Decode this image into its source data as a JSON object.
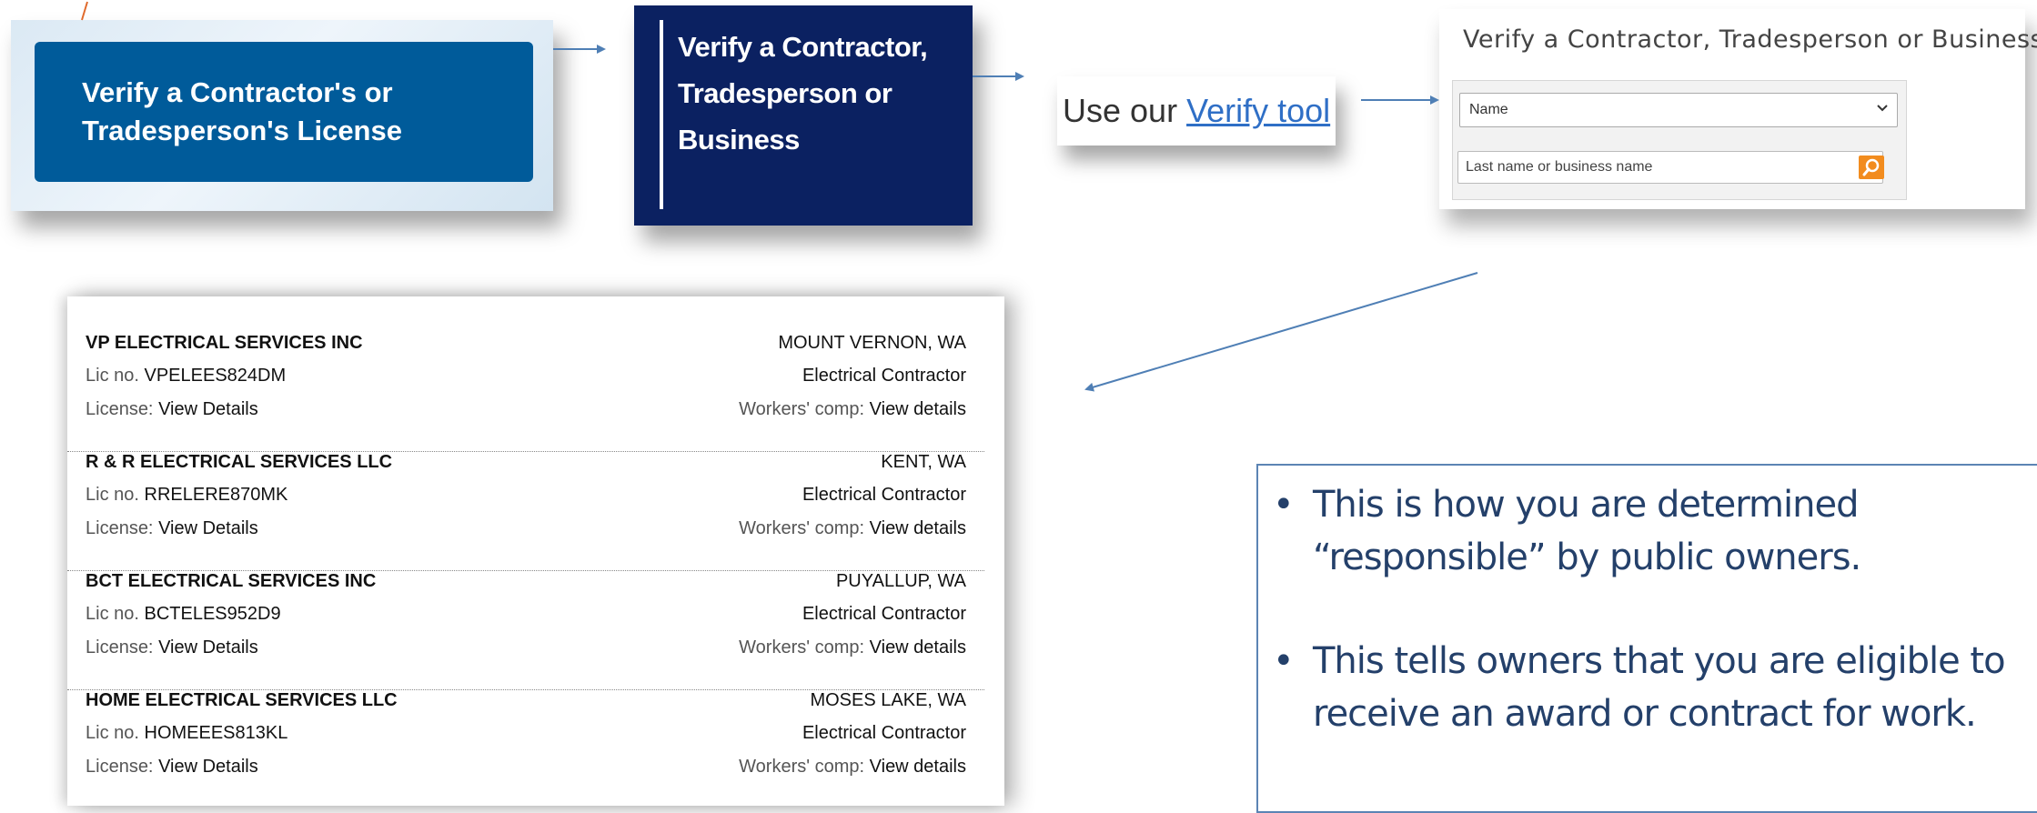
{
  "panel1": {
    "button_label": "Verify a Contractor's or Tradesperson's License"
  },
  "panel2": {
    "button_label": "Verify a Contractor, Tradesperson or Business"
  },
  "panel3": {
    "prefix": "Use our",
    "link": "Verify tool"
  },
  "panel4": {
    "title": "Verify a Contractor, Tradesperson or Business",
    "search_type": "Name",
    "search_placeholder": "Last name or business name"
  },
  "results": [
    {
      "name": "VP ELECTRICAL SERVICES INC",
      "location": "MOUNT VERNON, WA",
      "lic_label": "Lic no.",
      "lic_no": "VPELEES824DM",
      "type": "Electrical Contractor",
      "license_label": "License:",
      "license_link": "View Details",
      "comp_label": "Workers' comp:",
      "comp_link": "View details"
    },
    {
      "name": "R & R ELECTRICAL SERVICES LLC",
      "location": "KENT, WA",
      "lic_label": "Lic no.",
      "lic_no": "RRELERE870MK",
      "type": "Electrical Contractor",
      "license_label": "License:",
      "license_link": "View Details",
      "comp_label": "Workers' comp:",
      "comp_link": "View details"
    },
    {
      "name": "BCT ELECTRICAL SERVICES INC",
      "location": "PUYALLUP, WA",
      "lic_label": "Lic no.",
      "lic_no": "BCTELES952D9",
      "type": "Electrical Contractor",
      "license_label": "License:",
      "license_link": "View Details",
      "comp_label": "Workers' comp:",
      "comp_link": "View details"
    },
    {
      "name": "HOME ELECTRICAL SERVICES LLC",
      "location": "MOSES LAKE, WA",
      "lic_label": "Lic no.",
      "lic_no": "HOMEEES813KL",
      "type": "Electrical Contractor",
      "license_label": "License:",
      "license_link": "View Details",
      "comp_label": "Workers' comp:",
      "comp_link": "View details"
    }
  ],
  "notes": [
    "This is how you are determined “responsible” by public owners.",
    "This tells owners that you are eligible to receive an award or contract for work."
  ],
  "colors": {
    "accent_blue": "#005b9a",
    "navy": "#0b2161",
    "arrow": "#4f7fb5",
    "orange": "#e06a2c"
  }
}
